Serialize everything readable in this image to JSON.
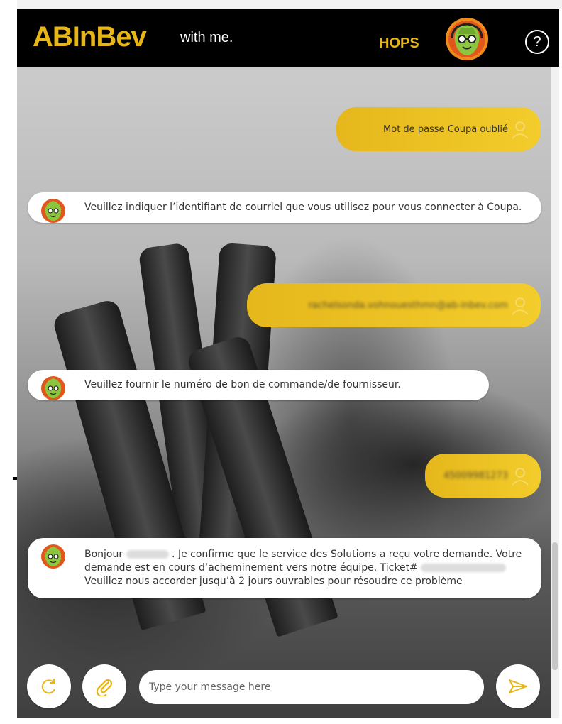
{
  "header": {
    "logo_text": "ABInBev",
    "tagline": "with me.",
    "bot_name": "HOPS",
    "help_label": "?"
  },
  "messages": [
    {
      "from": "user",
      "text": "Mot de passe Coupa oublié"
    },
    {
      "from": "bot",
      "text": "Veuillez indiquer l’identifiant de courriel que vous utilisez pour vous connecter à Coupa."
    },
    {
      "from": "user",
      "text": "rachelsonda.vohnouesthmn@ab-inbev.com"
    },
    {
      "from": "bot",
      "text": "Veuillez fournir le numéro de bon de commande/de fournisseur."
    },
    {
      "from": "user",
      "text": "45009981273"
    },
    {
      "from": "bot",
      "part1": "Bonjour",
      "part2": ". Je confirme que le service des Solutions a reçu votre demande. Votre demande est en cours d’acheminement vers notre équipe. Ticket#",
      "part3": "Veuillez nous accorder jusqu’à 2 jours ouvrables pour résoudre ce problème"
    }
  ],
  "input": {
    "placeholder": "Type your message here"
  },
  "icons": {
    "refresh": "refresh-icon",
    "attach": "paperclip-icon",
    "send": "send-icon",
    "user": "user-icon",
    "bot": "hops-avatar-icon"
  },
  "colors": {
    "brand_gold": "#e7b616",
    "header_bg": "#000000",
    "user_bubble": "#f0c624"
  }
}
